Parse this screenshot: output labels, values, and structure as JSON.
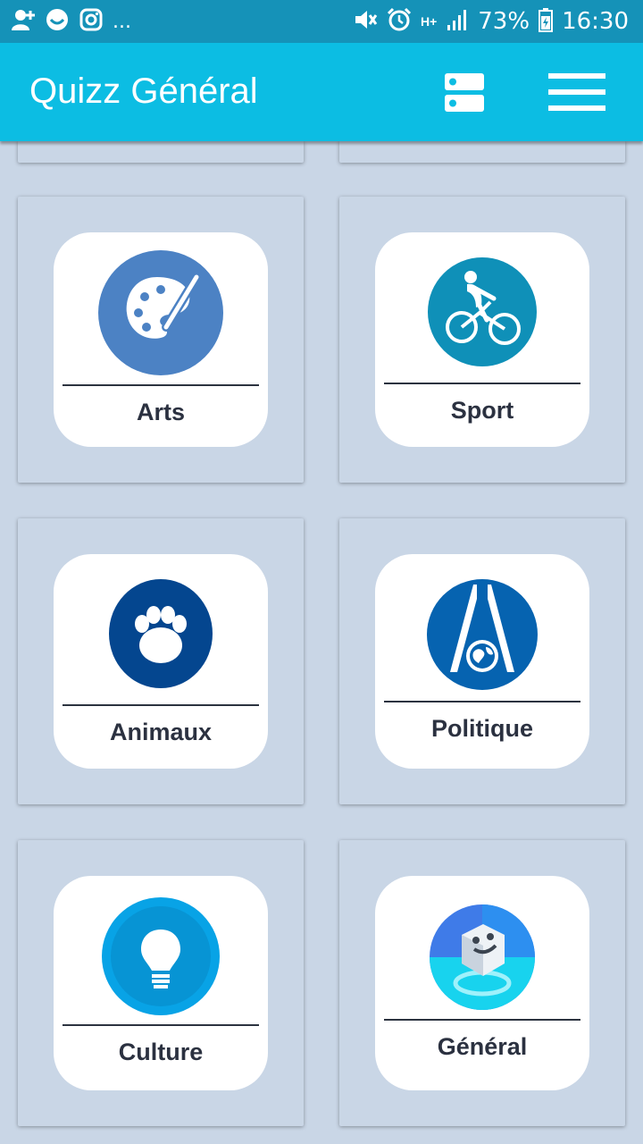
{
  "status_bar": {
    "battery": "73%",
    "time": "16:30",
    "network": "H+",
    "more_indicator": "...",
    "left_icons": [
      "add-contact-icon",
      "smiley-icon",
      "instagram-icon"
    ],
    "right_icons": [
      "mute-icon",
      "alarm-icon",
      "signal-icon",
      "battery-icon"
    ]
  },
  "app_bar": {
    "title": "Quizz Général",
    "actions": [
      "server-icon",
      "hamburger-menu-icon"
    ]
  },
  "colors": {
    "status_bar": "#1592b8",
    "app_bar": "#0cbde3",
    "background": "#c9d6e6",
    "label_text": "#2b3140"
  },
  "categories": [
    {
      "label": "Arts",
      "icon": "palette-icon",
      "color": "#4c82c4"
    },
    {
      "label": "Sport",
      "icon": "cyclist-icon",
      "color": "#0f90b8"
    },
    {
      "label": "Animaux",
      "icon": "paw-icon",
      "color": "#04468f"
    },
    {
      "label": "Politique",
      "icon": "globe-emblem-icon",
      "color": "#0663b0"
    },
    {
      "label": "Culture",
      "icon": "lightbulb-icon",
      "color": "#08a3e6"
    },
    {
      "label": "Général",
      "icon": "smiley-cube-icon",
      "color": "#3f7be8"
    }
  ]
}
